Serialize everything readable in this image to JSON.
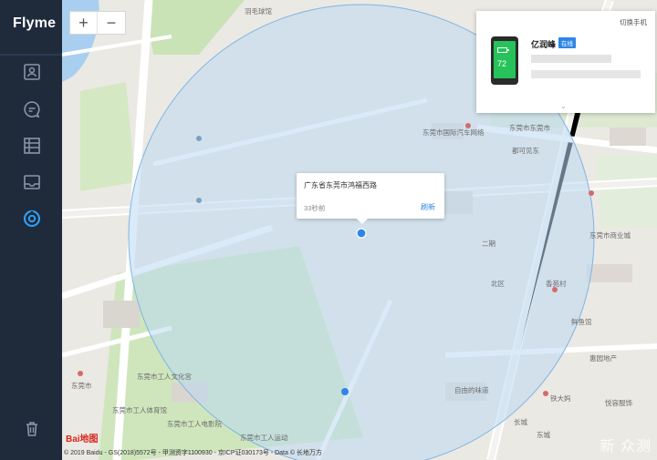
{
  "app": {
    "name": "Flyme"
  },
  "sidebar": {
    "items": [
      {
        "icon": "contacts-icon"
      },
      {
        "icon": "messages-icon"
      },
      {
        "icon": "gallery-icon"
      },
      {
        "icon": "inbox-icon"
      },
      {
        "icon": "locate-icon",
        "active": true
      }
    ],
    "bottom_icon": "trash-icon"
  },
  "map": {
    "zoom_in": "+",
    "zoom_out": "−",
    "popup": {
      "address": "广东省东莞市鸿福西路",
      "time": "33秒前",
      "refresh": "刷新"
    },
    "labels": [
      "羽毛球馆",
      "东莞市国际汽车网络",
      "东莞市东莞市",
      "都可见东",
      "二期",
      "北区",
      "东莞市商业城",
      "香苑村",
      "鲜鱼馆",
      "东莞市工人文化宫",
      "东莞市工人体育馆",
      "东莞市工人电影院",
      "自由的味道",
      "铁大妈",
      "长城",
      "东莞市",
      "东城",
      "东莞市工人运动",
      "惠园地产",
      "悦容服饰"
    ],
    "copyright": "© 2019 Baidu - GS(2018)5572号 - 甲测资字1100930 - 京ICP证030173号 - Data © 长地万方",
    "baidu_logo": "Bai地图",
    "watermark": "新 众测"
  },
  "device": {
    "switch_label": "切换手机",
    "name": "亿润峰",
    "status": "在线",
    "battery": "72"
  },
  "colors": {
    "sidebar_bg": "#1f2a3b",
    "accent": "#2f86e8",
    "battery_green": "#26c35a",
    "accuracy_circle": "#bcd9f2"
  }
}
